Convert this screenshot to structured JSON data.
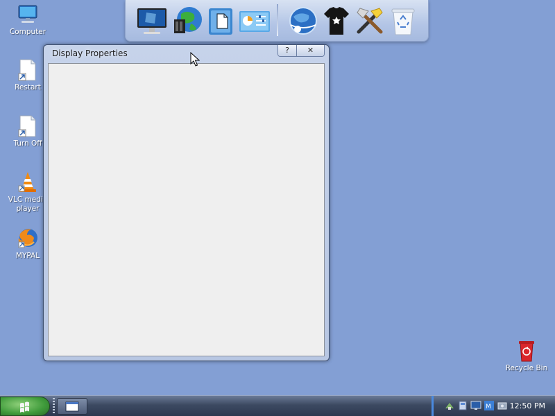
{
  "desktop": {
    "icons": [
      {
        "label": "Computer"
      },
      {
        "label": "Restart"
      },
      {
        "label": "Turn Off"
      },
      {
        "label": "VLC media player"
      },
      {
        "label": "MYPAL"
      },
      {
        "label": "Recycle Bin"
      }
    ]
  },
  "window": {
    "title": "Display Properties",
    "help_label": "?",
    "close_label": "✕"
  },
  "taskbar": {
    "clock": "12:50 PM"
  },
  "colors": {
    "desktop": "#839fd4",
    "taskbar": "#3d4a62",
    "window_client": "#efefef"
  }
}
